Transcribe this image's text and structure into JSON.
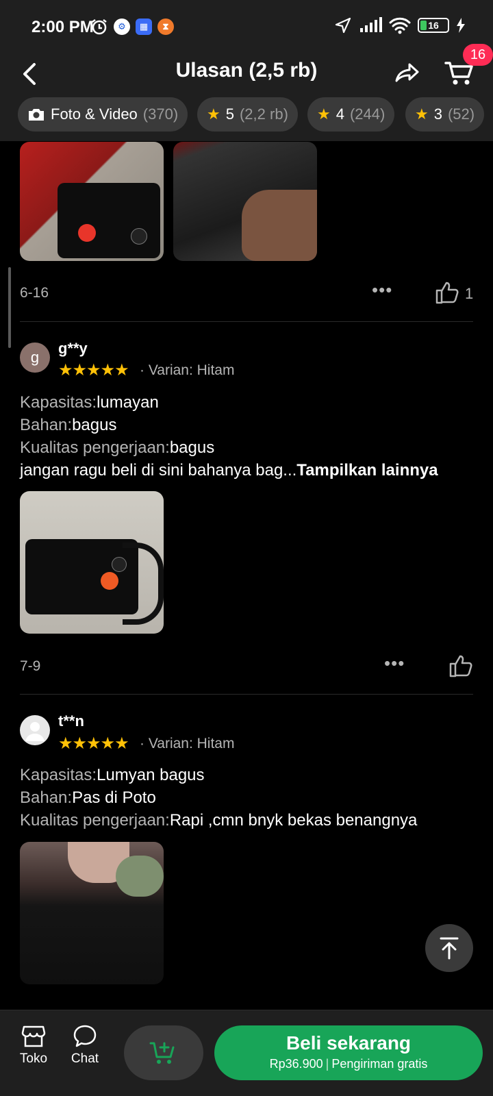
{
  "status_bar": {
    "time": "2:00 PM",
    "battery": "16"
  },
  "header": {
    "title": "Ulasan (2,5 rb)",
    "cart_badge": "16"
  },
  "filters": [
    {
      "label": "Foto & Video",
      "count": "(370)",
      "icon": "camera-icon"
    },
    {
      "label": "5",
      "count": "(2,2 rb)",
      "icon": "star-icon"
    },
    {
      "label": "4",
      "count": "(244)",
      "icon": "star-icon"
    },
    {
      "label": "3",
      "count": "(52)",
      "icon": "star-icon"
    }
  ],
  "reviews": [
    {
      "date": "6-16",
      "likes": "1"
    },
    {
      "avatar_letter": "g",
      "username": "g**y",
      "stars": "★★★★★",
      "variant": "· Varian: Hitam",
      "lines": [
        {
          "key": "Kapasitas:",
          "value": "lumayan"
        },
        {
          "key": "Bahan:",
          "value": "bagus"
        },
        {
          "key": "Kualitas pengerjaan:",
          "value": "bagus"
        }
      ],
      "text": "jangan ragu beli di sini bahanya bag...",
      "show_more": "Tampilkan lainnya",
      "date": "7-9"
    },
    {
      "username": "t**n",
      "stars": "★★★★★",
      "variant": "· Varian: Hitam",
      "lines": [
        {
          "key": "Kapasitas:",
          "value": "Lumyan bagus"
        },
        {
          "key": "Bahan:",
          "value": "Pas di Poto"
        },
        {
          "key": "Kualitas pengerjaan:",
          "value": "Rapi  ,cmn bnyk bekas benangnya"
        }
      ]
    }
  ],
  "bottom_bar": {
    "store_label": "Toko",
    "chat_label": "Chat",
    "buy_label": "Beli sekarang",
    "price": "Rp36.900",
    "shipping": "Pengiriman gratis"
  },
  "colors": {
    "accent_green": "#18a558",
    "badge_red": "#fe2c55",
    "star": "#ffc107"
  }
}
